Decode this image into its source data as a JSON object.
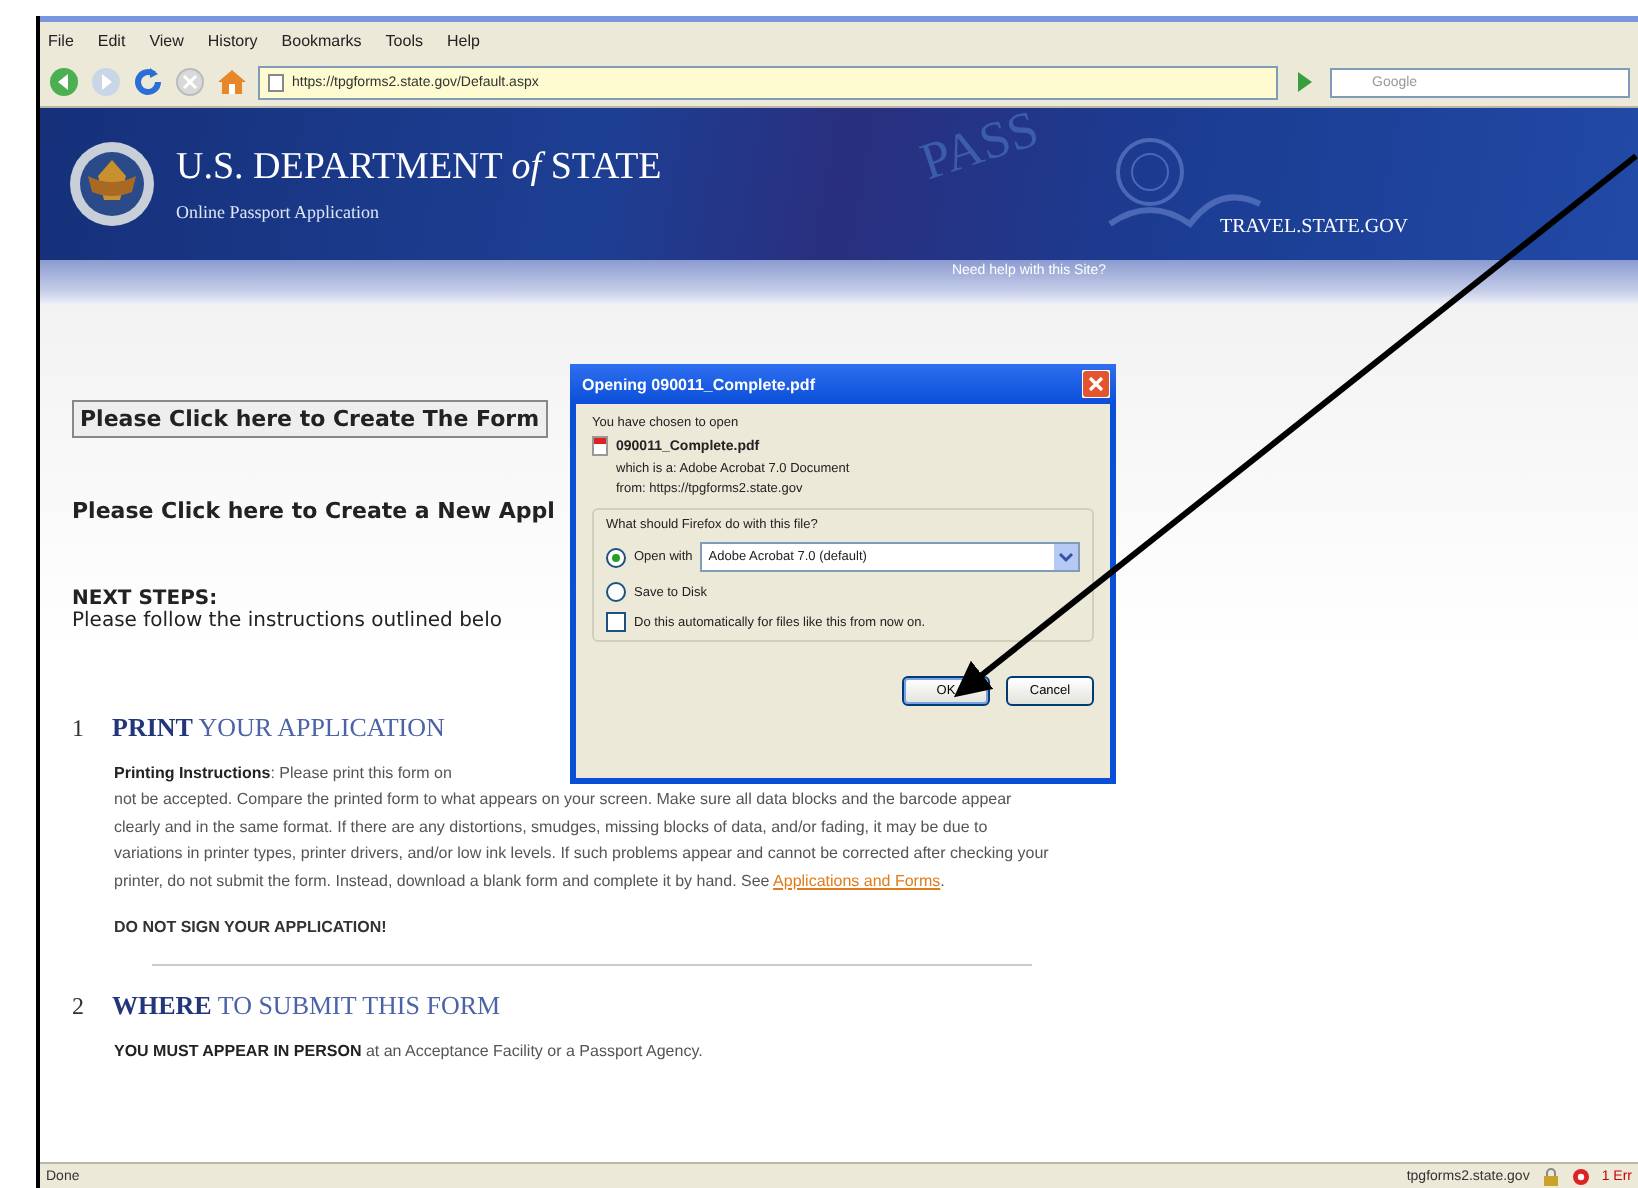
{
  "menu": [
    "File",
    "Edit",
    "View",
    "History",
    "Bookmarks",
    "Tools",
    "Help"
  ],
  "toolbar": {
    "url": "https://tpgforms2.state.gov/Default.aspx",
    "search_placeholder": "Google"
  },
  "header": {
    "title": "U.S. DEPARTMENT *of* STATE",
    "subtitle": "Online Passport Application",
    "watermark": "PASS",
    "site": "TRAVEL.STATE.GOV",
    "help": "Need help with this Site?"
  },
  "content": {
    "create_form_button": "Please Click here to Create The Form",
    "new_application_link": "Please Click here to Create a New Appl",
    "next_steps_title": "NEXT STEPS:",
    "next_steps_text": "Please follow the instructions outlined belo",
    "sections": [
      {
        "number": "1",
        "title": "**PRINT** YOUR APPLICATION",
        "first_line": "**Printing Instructions**: Please print this form on",
        "paragraph": "not be accepted. Compare the printed form to what appears on your screen. Make sure all data blocks and the barcode appear clearly and in the same format. If there are any distortions, smudges, missing blocks of data, and/or fading, it may be due to variations in printer types, printer drivers, and/or low ink levels. If such problems appear and cannot be corrected after checking your printer, do not submit the form. Instead, download a blank form and complete it by hand. See ",
        "link": "Applications and Forms",
        "after": ".",
        "warning": "DO NOT SIGN YOUR APPLICATION!"
      },
      {
        "number": "2",
        "title": "**WHERE** TO SUBMIT THIS FORM",
        "first_line": "**YOU MUST APPEAR IN PERSON** at an Acceptance Facility or a Passport Agency."
      }
    ]
  },
  "dialog": {
    "title": "Opening 090011_Complete.pdf",
    "intro": "You have chosen to open",
    "file_name": "090011_Complete.pdf",
    "file_type": "which is a:  Adobe Acrobat 7.0 Document",
    "file_from": "from:  https://tpgforms2.state.gov",
    "question": "What should Firefox do with this file?",
    "options": [
      {
        "kind": "radio",
        "label": "Open with",
        "selected": true,
        "dropdown": "Adobe Acrobat 7.0 (default)"
      },
      {
        "kind": "radio",
        "label": "Save to Disk",
        "selected": false
      },
      {
        "kind": "checkbox",
        "label": "Do this automatically for files like this from now on.",
        "checked": false
      }
    ],
    "buttons": [
      "OK",
      "Cancel"
    ]
  },
  "status": {
    "text": "Done",
    "host": "tpgforms2.state.gov",
    "errors": "1 Err"
  }
}
